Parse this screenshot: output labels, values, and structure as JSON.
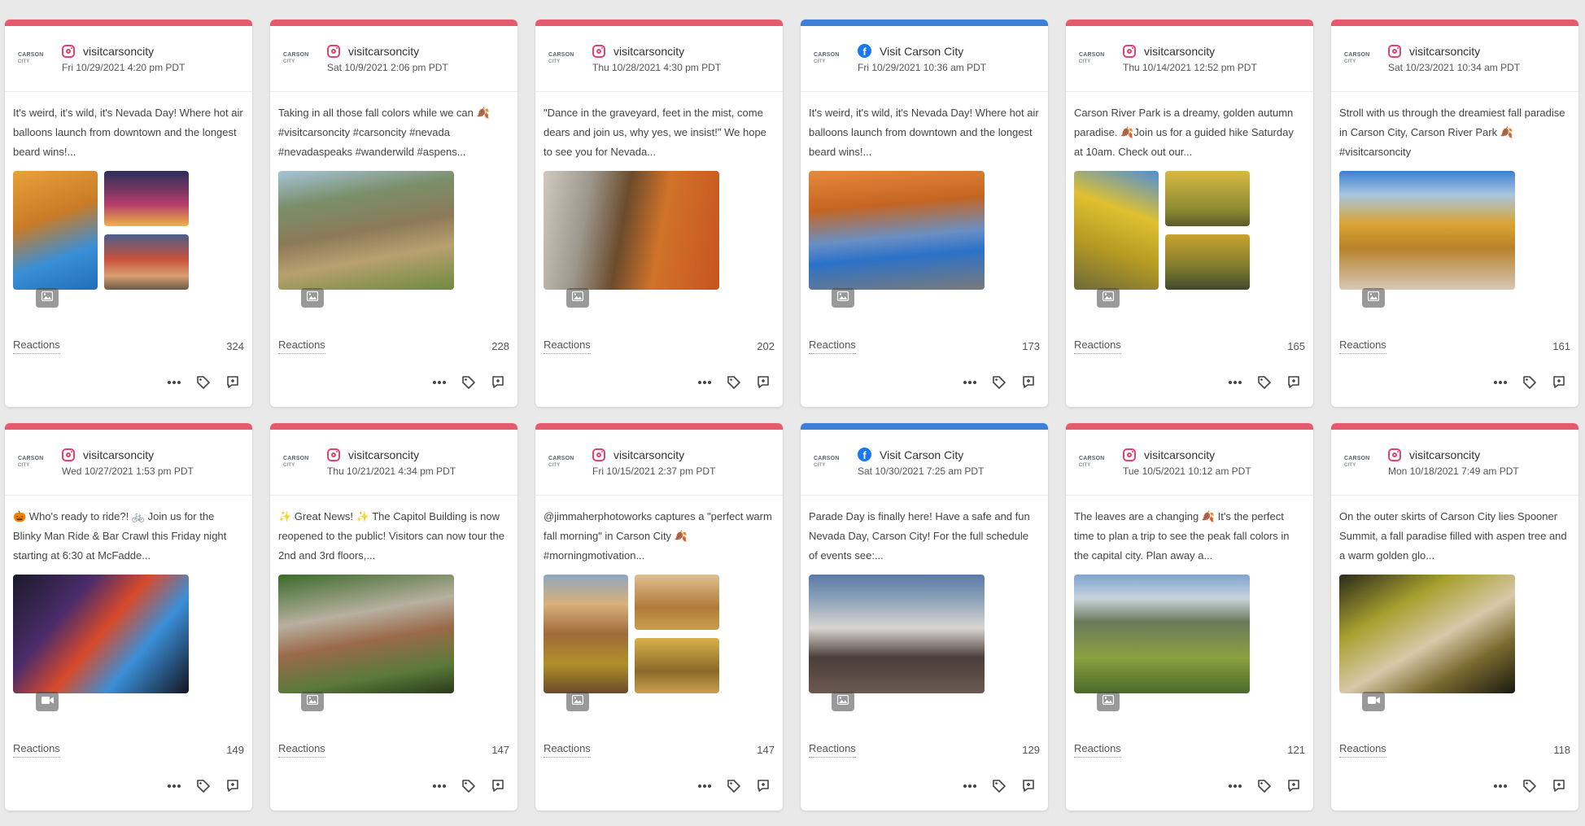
{
  "colors": {
    "instagram_accent": "#e55a6e",
    "facebook_accent": "#3e7fd9"
  },
  "logo_text": {
    "line1": "CARSON",
    "line2": "CITY"
  },
  "reactions_label": "Reactions",
  "posts": [
    {
      "network": "instagram",
      "account": "visitcarsoncity",
      "date": "Fri 10/29/2021 4:20 pm PDT",
      "text": "It's weird, it's wild, it's Nevada Day! Where hot air balloons launch from downtown and the longest beard wins!...",
      "reactions": "324",
      "media_icon": "image-icon"
    },
    {
      "network": "instagram",
      "account": "visitcarsoncity",
      "date": "Sat 10/9/2021 2:06 pm PDT",
      "text": "Taking in all those fall colors while we can 🍂 #visitcarsoncity #carsoncity #nevada #nevadaspeaks #wanderwild #aspens...",
      "reactions": "228",
      "media_icon": "image-icon"
    },
    {
      "network": "instagram",
      "account": "visitcarsoncity",
      "date": "Thu 10/28/2021 4:30 pm PDT",
      "text": "\"Dance in the graveyard, feet in the mist, come dears and join us, why yes, we insist!\" We hope to see you for Nevada...",
      "reactions": "202",
      "media_icon": "image-icon"
    },
    {
      "network": "facebook",
      "account": "Visit Carson City",
      "date": "Fri 10/29/2021 10:36 am PDT",
      "text": "It's weird, it's wild, it's Nevada Day! Where hot air balloons launch from downtown and the longest beard wins!...",
      "reactions": "173",
      "media_icon": "image-icon"
    },
    {
      "network": "instagram",
      "account": "visitcarsoncity",
      "date": "Thu 10/14/2021 12:52 pm PDT",
      "text": "Carson River Park is a dreamy, golden autumn paradise. 🍂Join us for a guided hike Saturday at 10am. Check out our...",
      "reactions": "165",
      "media_icon": "image-icon"
    },
    {
      "network": "instagram",
      "account": "visitcarsoncity",
      "date": "Sat 10/23/2021 10:34 am PDT",
      "text": "Stroll with us through the dreamiest fall paradise in Carson City, Carson River Park 🍂 #visitcarsoncity",
      "reactions": "161",
      "media_icon": "image-icon"
    },
    {
      "network": "instagram",
      "account": "visitcarsoncity",
      "date": "Wed 10/27/2021 1:53 pm PDT",
      "text": "🎃 Who's ready to ride?! 🚲 Join us for the Blinky Man Ride & Bar Crawl this Friday night starting at 6:30 at McFadde...",
      "reactions": "149",
      "media_icon": "video-icon"
    },
    {
      "network": "instagram",
      "account": "visitcarsoncity",
      "date": "Thu 10/21/2021 4:34 pm PDT",
      "text": "✨ Great News! ✨ The Capitol Building is now reopened to the public! Visitors can now tour the 2nd and 3rd floors,...",
      "reactions": "147",
      "media_icon": "image-icon"
    },
    {
      "network": "instagram",
      "account": "visitcarsoncity",
      "date": "Fri 10/15/2021 2:37 pm PDT",
      "text": "@jimmaherphotoworks captures a \"perfect warm fall morning\" in Carson City 🍂 #morningmotivation...",
      "reactions": "147",
      "media_icon": "image-icon"
    },
    {
      "network": "facebook",
      "account": "Visit Carson City",
      "date": "Sat 10/30/2021 7:25 am PDT",
      "text": "Parade Day is finally here! Have a safe and fun Nevada Day, Carson City! For the full schedule of events see:...",
      "reactions": "129",
      "media_icon": "image-icon"
    },
    {
      "network": "instagram",
      "account": "visitcarsoncity",
      "date": "Tue 10/5/2021 10:12 am PDT",
      "text": "The leaves are a changing 🍂 It's the perfect time to plan a trip to see the peak fall colors in the capital city. Plan away a...",
      "reactions": "121",
      "media_icon": "image-icon"
    },
    {
      "network": "instagram",
      "account": "visitcarsoncity",
      "date": "Mon 10/18/2021 7:49 am PDT",
      "text": "On the outer skirts of Carson City lies Spooner Summit, a fall paradise filled with aspen tree and a warm golden glo...",
      "reactions": "118",
      "media_icon": "video-icon"
    }
  ]
}
